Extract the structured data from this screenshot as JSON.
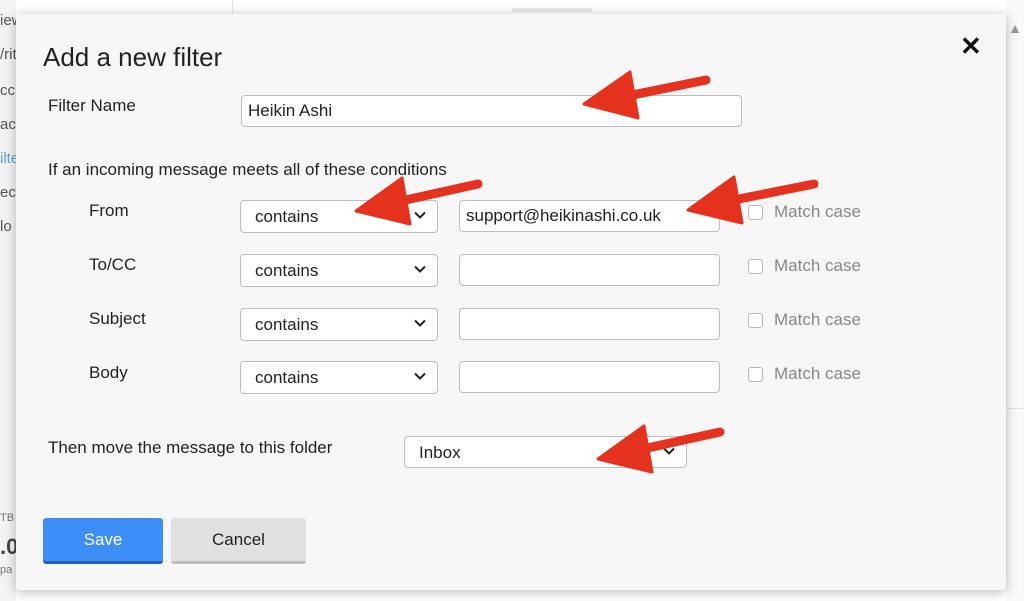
{
  "background": {
    "fragments": [
      "iew",
      "/rit",
      "cc",
      "ac",
      "ilte",
      "ec",
      "lo",
      "TB",
      ".0",
      "pa"
    ]
  },
  "dialog": {
    "title": "Add a new filter",
    "close_glyph": "✕",
    "filter_name_label": "Filter Name",
    "filter_name_value": "Heikin Ashi",
    "conditions_heading": "If an incoming message meets all of these conditions",
    "rows": [
      {
        "label": "From",
        "operator": "contains",
        "value": "support@heikinashi.co.uk",
        "match_case": "Match case",
        "checked": false
      },
      {
        "label": "To/CC",
        "operator": "contains",
        "value": "",
        "match_case": "Match case",
        "checked": false
      },
      {
        "label": "Subject",
        "operator": "contains",
        "value": "",
        "match_case": "Match case",
        "checked": false
      },
      {
        "label": "Body",
        "operator": "contains",
        "value": "",
        "match_case": "Match case",
        "checked": false
      }
    ],
    "folder_label": "Then move the message to this folder",
    "folder_value": "Inbox",
    "save_label": "Save",
    "cancel_label": "Cancel"
  },
  "colors": {
    "accent": "#3d8ef8",
    "annotation_arrow": "#e5321f"
  }
}
